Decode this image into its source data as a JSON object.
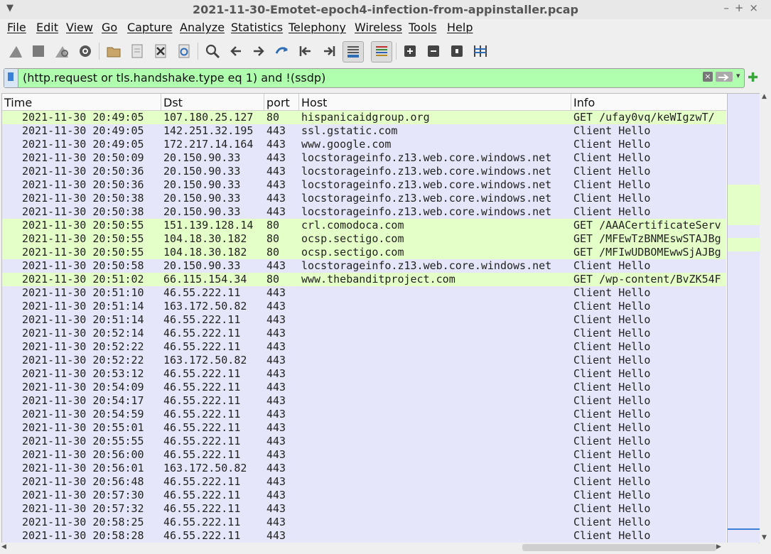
{
  "window": {
    "title": "2021-11-30-Emotet-epoch4-infection-from-appinstaller.pcap"
  },
  "menu": [
    "File",
    "Edit",
    "View",
    "Go",
    "Capture",
    "Analyze",
    "Statistics",
    "Telephony",
    "Wireless",
    "Tools",
    "Help"
  ],
  "filter": {
    "value": "(http.request or tls.handshake.type eq 1) and !(ssdp)"
  },
  "columns": {
    "time": "Time",
    "dst": "Dst",
    "port": "port",
    "host": "Host",
    "info": "Info"
  },
  "colors": {
    "http_row": "#e4ffc7",
    "tls_row": "#e6e6fa",
    "filter_valid": "#afffaf"
  },
  "rows": [
    {
      "time": "2021-11-30 20:49:05",
      "dst": "107.180.25.127",
      "port": "80",
      "host": "hispanicaidgroup.org",
      "info": "GET /ufay0vq/keWIgzwT/",
      "kind": "http"
    },
    {
      "time": "2021-11-30 20:49:05",
      "dst": "142.251.32.195",
      "port": "443",
      "host": "ssl.gstatic.com",
      "info": "Client Hello",
      "kind": "tls"
    },
    {
      "time": "2021-11-30 20:49:05",
      "dst": "172.217.14.164",
      "port": "443",
      "host": "www.google.com",
      "info": "Client Hello",
      "kind": "tls"
    },
    {
      "time": "2021-11-30 20:50:09",
      "dst": "20.150.90.33",
      "port": "443",
      "host": "locstorageinfo.z13.web.core.windows.net",
      "info": "Client Hello",
      "kind": "tls"
    },
    {
      "time": "2021-11-30 20:50:36",
      "dst": "20.150.90.33",
      "port": "443",
      "host": "locstorageinfo.z13.web.core.windows.net",
      "info": "Client Hello",
      "kind": "tls"
    },
    {
      "time": "2021-11-30 20:50:36",
      "dst": "20.150.90.33",
      "port": "443",
      "host": "locstorageinfo.z13.web.core.windows.net",
      "info": "Client Hello",
      "kind": "tls"
    },
    {
      "time": "2021-11-30 20:50:38",
      "dst": "20.150.90.33",
      "port": "443",
      "host": "locstorageinfo.z13.web.core.windows.net",
      "info": "Client Hello",
      "kind": "tls"
    },
    {
      "time": "2021-11-30 20:50:38",
      "dst": "20.150.90.33",
      "port": "443",
      "host": "locstorageinfo.z13.web.core.windows.net",
      "info": "Client Hello",
      "kind": "tls"
    },
    {
      "time": "2021-11-30 20:50:55",
      "dst": "151.139.128.14",
      "port": "80",
      "host": "crl.comodoca.com",
      "info": "GET /AAACertificateServ",
      "kind": "http"
    },
    {
      "time": "2021-11-30 20:50:55",
      "dst": "104.18.30.182",
      "port": "80",
      "host": "ocsp.sectigo.com",
      "info": "GET /MFEwTzBNMEswSTAJBg",
      "kind": "http"
    },
    {
      "time": "2021-11-30 20:50:55",
      "dst": "104.18.30.182",
      "port": "80",
      "host": "ocsp.sectigo.com",
      "info": "GET /MFIwUDBOMEwwSjAJBg",
      "kind": "http"
    },
    {
      "time": "2021-11-30 20:50:58",
      "dst": "20.150.90.33",
      "port": "443",
      "host": "locstorageinfo.z13.web.core.windows.net",
      "info": "Client Hello",
      "kind": "tls"
    },
    {
      "time": "2021-11-30 20:51:02",
      "dst": "66.115.154.34",
      "port": "80",
      "host": "www.thebanditproject.com",
      "info": "GET /wp-content/BvZK54F",
      "kind": "http"
    },
    {
      "time": "2021-11-30 20:51:10",
      "dst": "46.55.222.11",
      "port": "443",
      "host": "",
      "info": "Client Hello",
      "kind": "tls"
    },
    {
      "time": "2021-11-30 20:51:14",
      "dst": "163.172.50.82",
      "port": "443",
      "host": "",
      "info": "Client Hello",
      "kind": "tls"
    },
    {
      "time": "2021-11-30 20:51:14",
      "dst": "46.55.222.11",
      "port": "443",
      "host": "",
      "info": "Client Hello",
      "kind": "tls"
    },
    {
      "time": "2021-11-30 20:52:14",
      "dst": "46.55.222.11",
      "port": "443",
      "host": "",
      "info": "Client Hello",
      "kind": "tls"
    },
    {
      "time": "2021-11-30 20:52:22",
      "dst": "46.55.222.11",
      "port": "443",
      "host": "",
      "info": "Client Hello",
      "kind": "tls"
    },
    {
      "time": "2021-11-30 20:52:22",
      "dst": "163.172.50.82",
      "port": "443",
      "host": "",
      "info": "Client Hello",
      "kind": "tls"
    },
    {
      "time": "2021-11-30 20:53:12",
      "dst": "46.55.222.11",
      "port": "443",
      "host": "",
      "info": "Client Hello",
      "kind": "tls"
    },
    {
      "time": "2021-11-30 20:54:09",
      "dst": "46.55.222.11",
      "port": "443",
      "host": "",
      "info": "Client Hello",
      "kind": "tls"
    },
    {
      "time": "2021-11-30 20:54:17",
      "dst": "46.55.222.11",
      "port": "443",
      "host": "",
      "info": "Client Hello",
      "kind": "tls"
    },
    {
      "time": "2021-11-30 20:54:59",
      "dst": "46.55.222.11",
      "port": "443",
      "host": "",
      "info": "Client Hello",
      "kind": "tls"
    },
    {
      "time": "2021-11-30 20:55:01",
      "dst": "46.55.222.11",
      "port": "443",
      "host": "",
      "info": "Client Hello",
      "kind": "tls"
    },
    {
      "time": "2021-11-30 20:55:55",
      "dst": "46.55.222.11",
      "port": "443",
      "host": "",
      "info": "Client Hello",
      "kind": "tls"
    },
    {
      "time": "2021-11-30 20:56:00",
      "dst": "46.55.222.11",
      "port": "443",
      "host": "",
      "info": "Client Hello",
      "kind": "tls"
    },
    {
      "time": "2021-11-30 20:56:01",
      "dst": "163.172.50.82",
      "port": "443",
      "host": "",
      "info": "Client Hello",
      "kind": "tls"
    },
    {
      "time": "2021-11-30 20:56:48",
      "dst": "46.55.222.11",
      "port": "443",
      "host": "",
      "info": "Client Hello",
      "kind": "tls"
    },
    {
      "time": "2021-11-30 20:57:30",
      "dst": "46.55.222.11",
      "port": "443",
      "host": "",
      "info": "Client Hello",
      "kind": "tls"
    },
    {
      "time": "2021-11-30 20:57:32",
      "dst": "46.55.222.11",
      "port": "443",
      "host": "",
      "info": "Client Hello",
      "kind": "tls"
    },
    {
      "time": "2021-11-30 20:58:25",
      "dst": "46.55.222.11",
      "port": "443",
      "host": "",
      "info": "Client Hello",
      "kind": "tls"
    },
    {
      "time": "2021-11-30 20:58:28",
      "dst": "46.55.222.11",
      "port": "443",
      "host": "",
      "info": "Client Hello",
      "kind": "tls"
    }
  ]
}
